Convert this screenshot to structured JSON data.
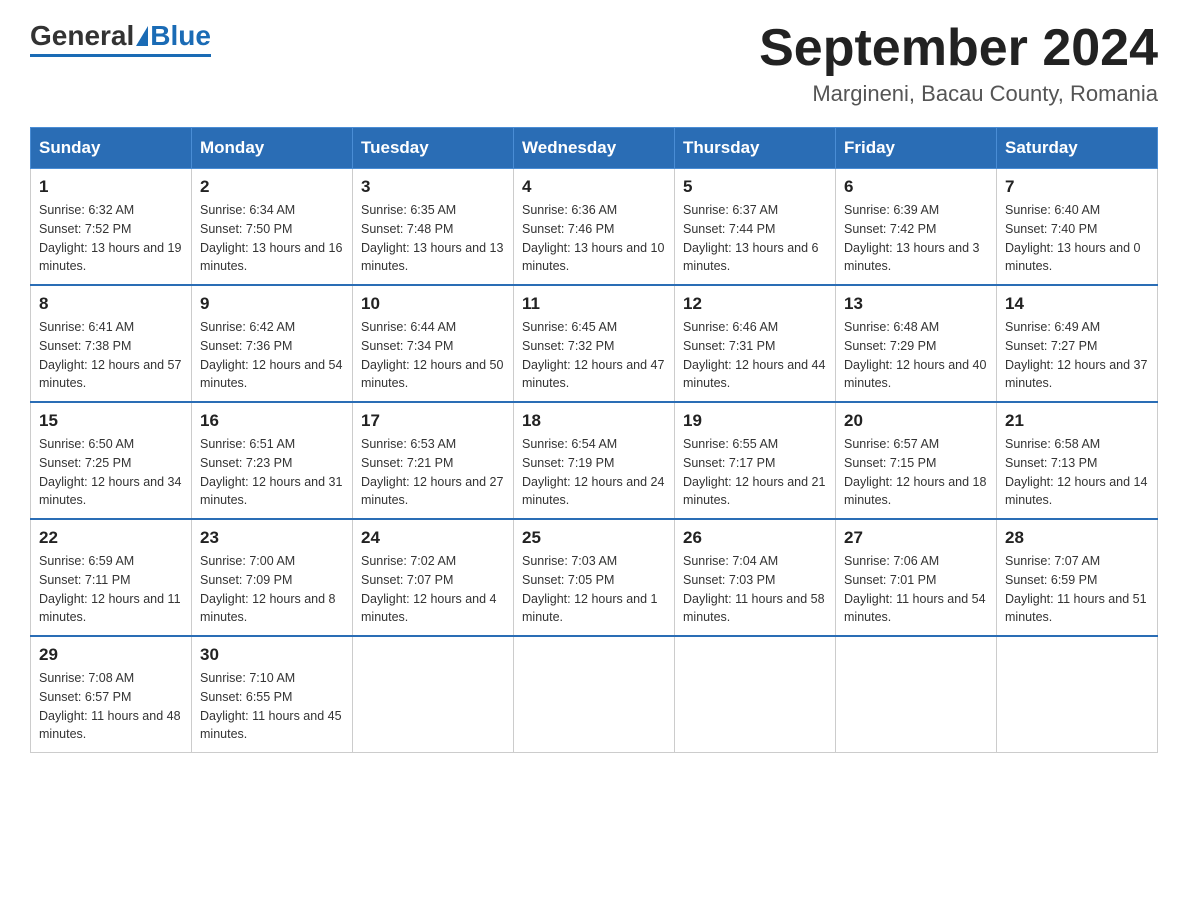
{
  "header": {
    "logo_general": "General",
    "logo_blue": "Blue",
    "month_title": "September 2024",
    "location": "Margineni, Bacau County, Romania"
  },
  "days_of_week": [
    "Sunday",
    "Monday",
    "Tuesday",
    "Wednesday",
    "Thursday",
    "Friday",
    "Saturday"
  ],
  "weeks": [
    [
      {
        "day": "1",
        "sunrise": "6:32 AM",
        "sunset": "7:52 PM",
        "daylight": "13 hours and 19 minutes."
      },
      {
        "day": "2",
        "sunrise": "6:34 AM",
        "sunset": "7:50 PM",
        "daylight": "13 hours and 16 minutes."
      },
      {
        "day": "3",
        "sunrise": "6:35 AM",
        "sunset": "7:48 PM",
        "daylight": "13 hours and 13 minutes."
      },
      {
        "day": "4",
        "sunrise": "6:36 AM",
        "sunset": "7:46 PM",
        "daylight": "13 hours and 10 minutes."
      },
      {
        "day": "5",
        "sunrise": "6:37 AM",
        "sunset": "7:44 PM",
        "daylight": "13 hours and 6 minutes."
      },
      {
        "day": "6",
        "sunrise": "6:39 AM",
        "sunset": "7:42 PM",
        "daylight": "13 hours and 3 minutes."
      },
      {
        "day": "7",
        "sunrise": "6:40 AM",
        "sunset": "7:40 PM",
        "daylight": "13 hours and 0 minutes."
      }
    ],
    [
      {
        "day": "8",
        "sunrise": "6:41 AM",
        "sunset": "7:38 PM",
        "daylight": "12 hours and 57 minutes."
      },
      {
        "day": "9",
        "sunrise": "6:42 AM",
        "sunset": "7:36 PM",
        "daylight": "12 hours and 54 minutes."
      },
      {
        "day": "10",
        "sunrise": "6:44 AM",
        "sunset": "7:34 PM",
        "daylight": "12 hours and 50 minutes."
      },
      {
        "day": "11",
        "sunrise": "6:45 AM",
        "sunset": "7:32 PM",
        "daylight": "12 hours and 47 minutes."
      },
      {
        "day": "12",
        "sunrise": "6:46 AM",
        "sunset": "7:31 PM",
        "daylight": "12 hours and 44 minutes."
      },
      {
        "day": "13",
        "sunrise": "6:48 AM",
        "sunset": "7:29 PM",
        "daylight": "12 hours and 40 minutes."
      },
      {
        "day": "14",
        "sunrise": "6:49 AM",
        "sunset": "7:27 PM",
        "daylight": "12 hours and 37 minutes."
      }
    ],
    [
      {
        "day": "15",
        "sunrise": "6:50 AM",
        "sunset": "7:25 PM",
        "daylight": "12 hours and 34 minutes."
      },
      {
        "day": "16",
        "sunrise": "6:51 AM",
        "sunset": "7:23 PM",
        "daylight": "12 hours and 31 minutes."
      },
      {
        "day": "17",
        "sunrise": "6:53 AM",
        "sunset": "7:21 PM",
        "daylight": "12 hours and 27 minutes."
      },
      {
        "day": "18",
        "sunrise": "6:54 AM",
        "sunset": "7:19 PM",
        "daylight": "12 hours and 24 minutes."
      },
      {
        "day": "19",
        "sunrise": "6:55 AM",
        "sunset": "7:17 PM",
        "daylight": "12 hours and 21 minutes."
      },
      {
        "day": "20",
        "sunrise": "6:57 AM",
        "sunset": "7:15 PM",
        "daylight": "12 hours and 18 minutes."
      },
      {
        "day": "21",
        "sunrise": "6:58 AM",
        "sunset": "7:13 PM",
        "daylight": "12 hours and 14 minutes."
      }
    ],
    [
      {
        "day": "22",
        "sunrise": "6:59 AM",
        "sunset": "7:11 PM",
        "daylight": "12 hours and 11 minutes."
      },
      {
        "day": "23",
        "sunrise": "7:00 AM",
        "sunset": "7:09 PM",
        "daylight": "12 hours and 8 minutes."
      },
      {
        "day": "24",
        "sunrise": "7:02 AM",
        "sunset": "7:07 PM",
        "daylight": "12 hours and 4 minutes."
      },
      {
        "day": "25",
        "sunrise": "7:03 AM",
        "sunset": "7:05 PM",
        "daylight": "12 hours and 1 minute."
      },
      {
        "day": "26",
        "sunrise": "7:04 AM",
        "sunset": "7:03 PM",
        "daylight": "11 hours and 58 minutes."
      },
      {
        "day": "27",
        "sunrise": "7:06 AM",
        "sunset": "7:01 PM",
        "daylight": "11 hours and 54 minutes."
      },
      {
        "day": "28",
        "sunrise": "7:07 AM",
        "sunset": "6:59 PM",
        "daylight": "11 hours and 51 minutes."
      }
    ],
    [
      {
        "day": "29",
        "sunrise": "7:08 AM",
        "sunset": "6:57 PM",
        "daylight": "11 hours and 48 minutes."
      },
      {
        "day": "30",
        "sunrise": "7:10 AM",
        "sunset": "6:55 PM",
        "daylight": "11 hours and 45 minutes."
      },
      null,
      null,
      null,
      null,
      null
    ]
  ],
  "labels": {
    "sunrise": "Sunrise:",
    "sunset": "Sunset:",
    "daylight": "Daylight:"
  }
}
